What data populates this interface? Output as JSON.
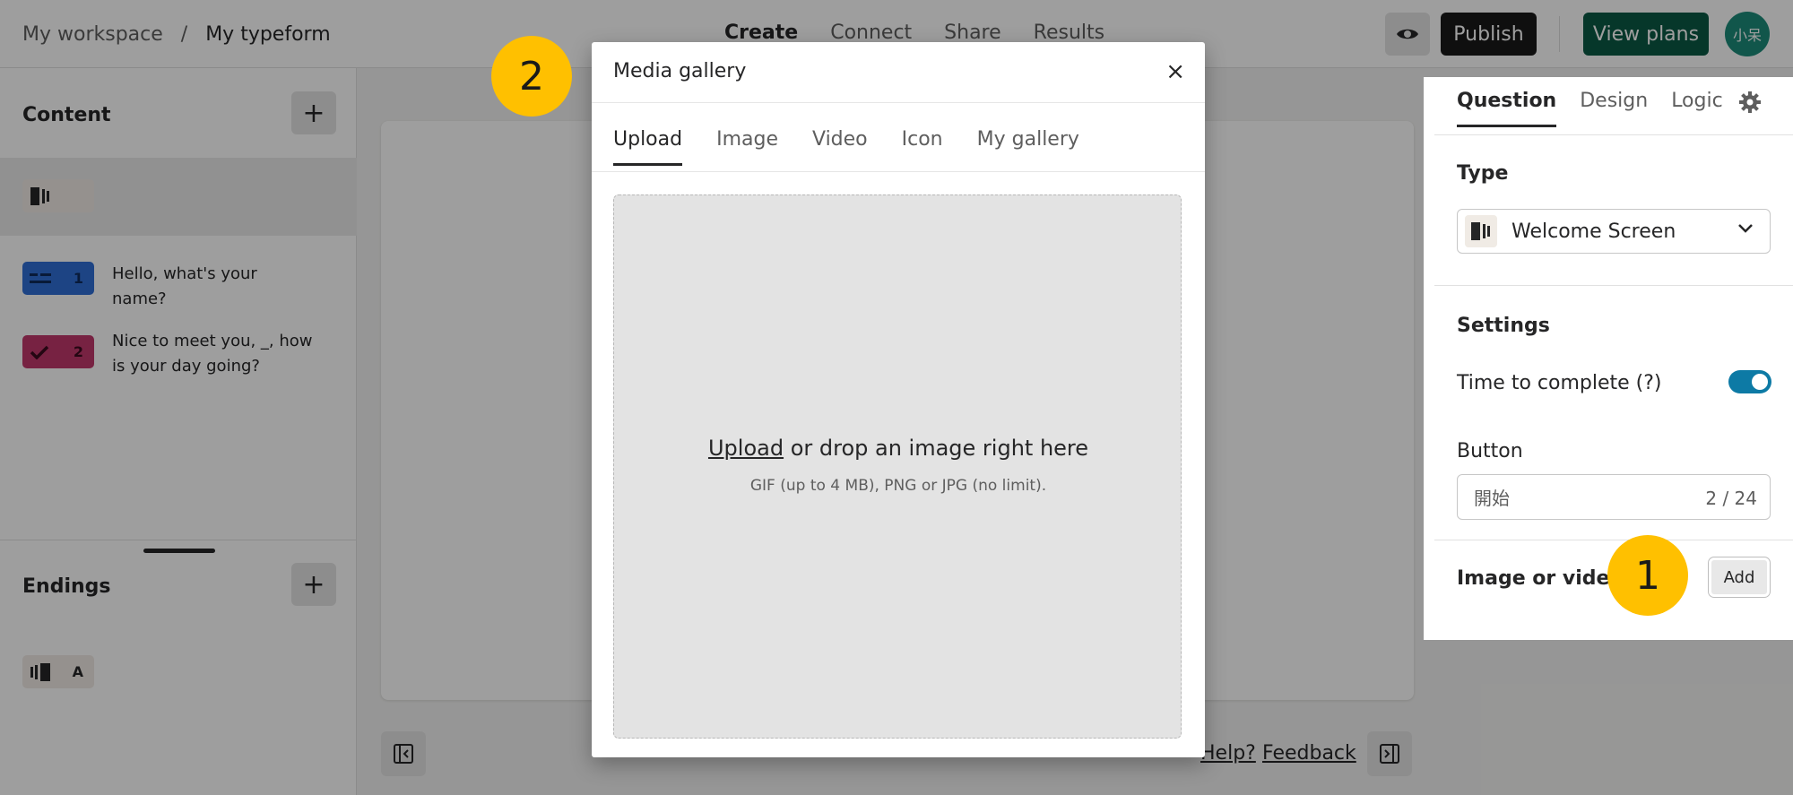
{
  "header": {
    "breadcrumb_workspace": "My workspace",
    "breadcrumb_separator": "/",
    "breadcrumb_form": "My typeform",
    "tabs": [
      {
        "label": "Create",
        "active": true
      },
      {
        "label": "Connect"
      },
      {
        "label": "Share"
      },
      {
        "label": "Results"
      }
    ],
    "publish_label": "Publish",
    "view_plans_label": "View plans",
    "avatar_text": "小呆"
  },
  "sidebar": {
    "content_heading": "Content",
    "questions": [
      {
        "number": "1",
        "text": "Hello, what's your name?",
        "color": "#2f6fd6"
      },
      {
        "number": "2",
        "text": "Nice to meet you, _, how is your day going?",
        "color": "#c0376b"
      }
    ],
    "endings_heading": "Endings",
    "ending_letter": "A"
  },
  "canvas": {
    "help_link": "Help?",
    "feedback_link": "Feedback"
  },
  "right_panel": {
    "tabs": [
      {
        "label": "Question",
        "active": true
      },
      {
        "label": "Design"
      },
      {
        "label": "Logic"
      }
    ],
    "type_heading": "Type",
    "type_value": "Welcome Screen",
    "settings_heading": "Settings",
    "time_to_complete_label": "Time to complete (?)",
    "time_to_complete_on": true,
    "button_heading": "Button",
    "button_value": "開始",
    "button_count": "2 / 24",
    "image_video_heading": "Image or video",
    "add_label": "Add"
  },
  "modal": {
    "title": "Media gallery",
    "close_glyph": "×",
    "tabs": [
      {
        "label": "Upload",
        "active": true
      },
      {
        "label": "Image"
      },
      {
        "label": "Video"
      },
      {
        "label": "Icon"
      },
      {
        "label": "My gallery"
      }
    ],
    "drop_link": "Upload",
    "drop_text": " or drop an image right here",
    "drop_hint": "GIF (up to 4 MB), PNG or JPG (no limit)."
  },
  "markers": {
    "one": "1",
    "two": "2"
  },
  "colors": {
    "accent_green": "#0a5a45",
    "toggle_blue": "#0d7aa5",
    "marker_yellow": "#ffc000"
  }
}
